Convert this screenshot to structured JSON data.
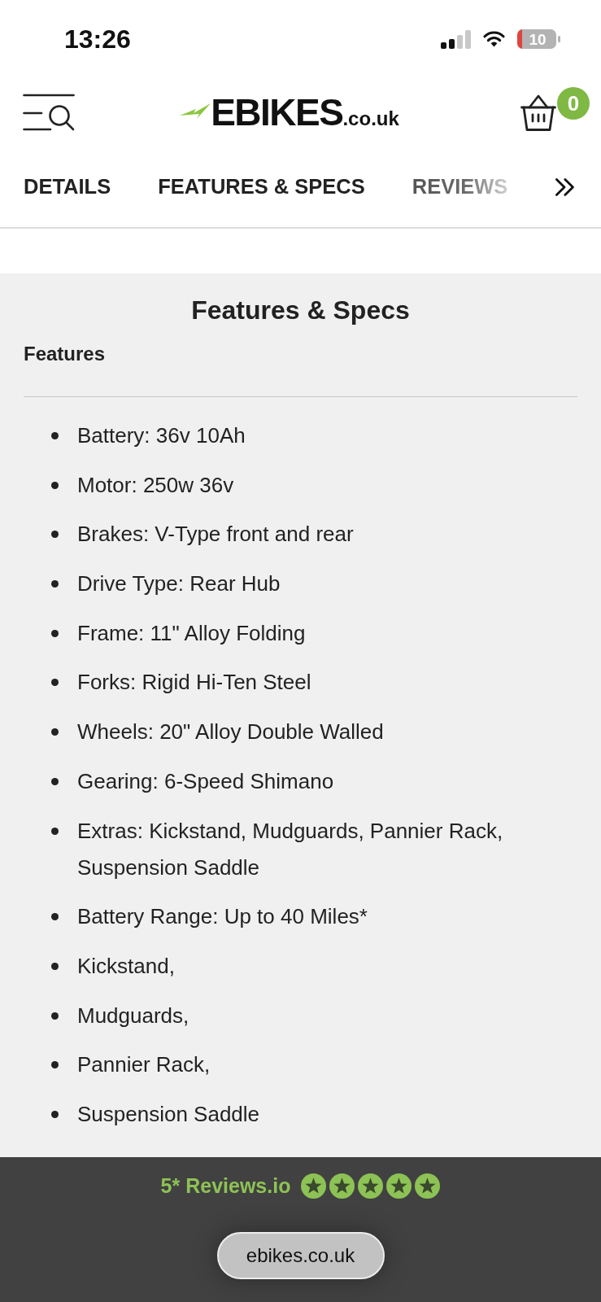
{
  "status_bar": {
    "time": "13:26",
    "battery": "10"
  },
  "header": {
    "logo": {
      "wordmark": "EBIKES",
      "domain": ".co.uk"
    },
    "cart_count": "0"
  },
  "tabs": [
    {
      "label": "DETAILS",
      "faded": false
    },
    {
      "label": "FEATURES & SPECS",
      "faded": false
    },
    {
      "label": "REVIEWS",
      "faded": true
    }
  ],
  "section": {
    "title": "Features & Specs",
    "subtitle": "Features",
    "items": [
      "Battery: 36v 10Ah",
      "Motor: 250w 36v",
      "Brakes: V-Type front and rear",
      "Drive Type: Rear Hub",
      "Frame: 11\" Alloy Folding",
      "Forks: Rigid Hi-Ten Steel",
      "Wheels: 20\" Alloy Double Walled",
      "Gearing: 6-Speed Shimano",
      "Extras: Kickstand, Mudguards, Pannier Rack, Suspension Saddle",
      "Battery Range: Up to 40 Miles*",
      "Kickstand,",
      "Mudguards,",
      "Pannier Rack,",
      "Suspension Saddle"
    ]
  },
  "footer": {
    "rating": {
      "label": "5* Reviews.io",
      "stars": 5
    },
    "address": "ebikes.co.uk"
  }
}
